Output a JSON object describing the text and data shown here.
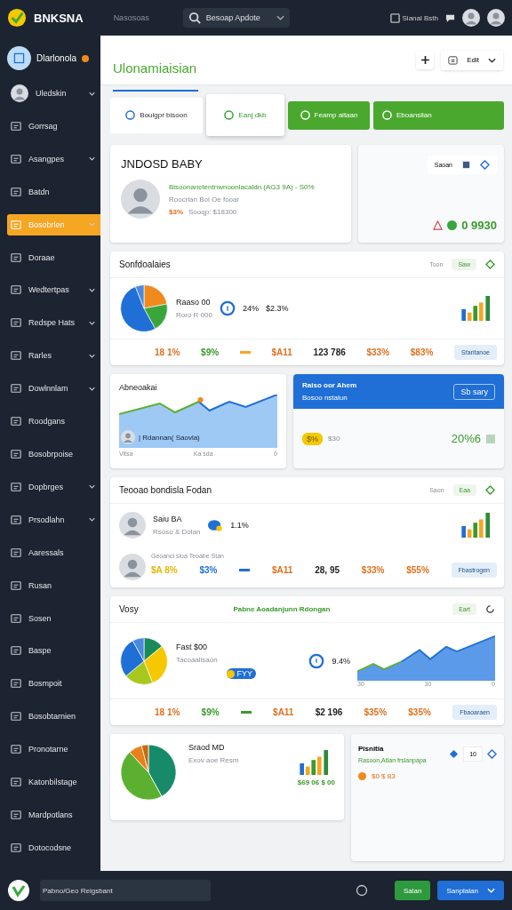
{
  "topbar": {
    "brand": "BNKSNA",
    "section": "Nasosoas",
    "search": {
      "value": "Besoap Apdote"
    },
    "account": "Sianal Bsth"
  },
  "sidebar": {
    "profile": {
      "name": "Dlarlonola",
      "badge": true
    },
    "items": [
      {
        "label": "Uledskin",
        "kind": "user",
        "expandable": true,
        "selected": false
      },
      {
        "label": "Gorrsag",
        "kind": "item",
        "expandable": false,
        "selected": false
      },
      {
        "label": "Asangpes",
        "kind": "item",
        "expandable": true,
        "selected": false
      },
      {
        "label": "Batdn",
        "kind": "item",
        "expandable": false,
        "selected": false
      },
      {
        "label": "Bosobrlen",
        "kind": "item",
        "expandable": true,
        "selected": true
      },
      {
        "label": "Doraae",
        "kind": "item",
        "expandable": false,
        "selected": false
      },
      {
        "label": "Wedtertpas",
        "kind": "item",
        "expandable": true,
        "selected": false
      },
      {
        "label": "Redspe Hats",
        "kind": "item",
        "expandable": true,
        "selected": false
      },
      {
        "label": "Rarles",
        "kind": "item",
        "expandable": true,
        "selected": false
      },
      {
        "label": "Dowlnnlam",
        "kind": "item",
        "expandable": true,
        "selected": false
      },
      {
        "label": "Roodgans",
        "kind": "item",
        "expandable": false,
        "selected": false
      },
      {
        "label": "Bosobrpoise",
        "kind": "item",
        "expandable": false,
        "selected": false
      },
      {
        "label": "Dopbrges",
        "kind": "item",
        "expandable": true,
        "selected": false
      },
      {
        "label": "Prsodlahn",
        "kind": "item",
        "expandable": true,
        "selected": false
      },
      {
        "label": "Aaressals",
        "kind": "item",
        "expandable": false,
        "selected": false
      },
      {
        "label": "Rusan",
        "kind": "item",
        "expandable": false,
        "selected": false
      },
      {
        "label": "Sosen",
        "kind": "item",
        "expandable": false,
        "selected": false
      },
      {
        "label": "Baspe",
        "kind": "item",
        "expandable": false,
        "selected": false
      },
      {
        "label": "Bosmpoit",
        "kind": "item",
        "expandable": false,
        "selected": false
      },
      {
        "label": "Bosobtarnien",
        "kind": "item",
        "expandable": false,
        "selected": false
      },
      {
        "label": "Pronotarne",
        "kind": "item",
        "expandable": false,
        "selected": false
      },
      {
        "label": "Katonbilstage",
        "kind": "item",
        "expandable": false,
        "selected": false
      },
      {
        "label": "Mardpotlans",
        "kind": "item",
        "expandable": false,
        "selected": false
      },
      {
        "label": "Dotocodsne",
        "kind": "item",
        "expandable": false,
        "selected": false
      }
    ]
  },
  "header": {
    "title": "Ulonamiaisian",
    "action": "Edit"
  },
  "actions": [
    {
      "label": "Bouigpr bisoon",
      "kind": "outline"
    },
    {
      "label": "Eanj dkb",
      "kind": "raised"
    },
    {
      "label": "Feamp aitaan",
      "kind": "filled"
    },
    {
      "label": "Eboanslian",
      "kind": "filled"
    }
  ],
  "profile_card": {
    "title": "JNDOSD BABY",
    "headline": "Bisoonanctentnwnoonlacaldn  (AG3 9A) - S0%",
    "subtitle": "Roocrlan Bol Oe fooar",
    "tag": "$3%",
    "amount": "Sooqp: $18300"
  },
  "side_card": {
    "pill": "Saoan",
    "value": "0 9930"
  },
  "summary_card": {
    "title": "Sonfdoalaies",
    "meta": "Toon",
    "pill": "Saw",
    "name": "Raaso 00",
    "note": "Roro R 000",
    "rate": "24%",
    "change": "$2.3%",
    "footer": [
      {
        "kind": "text",
        "text": "18 1%",
        "color": "#e0701e"
      },
      {
        "kind": "text",
        "text": "$9%",
        "color": "#3a9a2c"
      },
      {
        "kind": "dash",
        "color": "#f5a623"
      },
      {
        "kind": "text",
        "text": "$A11",
        "color": "#e0701e"
      },
      {
        "kind": "text",
        "text": "123 786",
        "color": "#222222"
      },
      {
        "kind": "text",
        "text": "$33%",
        "color": "#e0701e"
      },
      {
        "kind": "text",
        "text": "$83%",
        "color": "#e0701e"
      }
    ],
    "button": "Sfaritanoe"
  },
  "trend_card": {
    "title": "Abneoakai",
    "overlay": "| Rdannan( Saovla)",
    "axis": [
      "Vitsa",
      "Ka sda",
      "0"
    ]
  },
  "promo_card": {
    "title": "Raiso oor Ahem",
    "subtitle": "Bosoo nstaiun",
    "button": "Sb sary",
    "pill": "$%",
    "amount": "$30",
    "rate": "20%6"
  },
  "team_card": {
    "title": "Teooao bondisla Fodan",
    "meta": "Saon",
    "pill": "Eaa",
    "name": "Saiu BA",
    "role": "Rsoso & Dolan",
    "rate": "1.1%",
    "caption": "Geoancl sloa Teoabe Stan",
    "footer": [
      {
        "kind": "text",
        "text": "$A 8%",
        "color": "#e8b400"
      },
      {
        "kind": "text",
        "text": "$3%",
        "color": "#1f6fd6"
      },
      {
        "kind": "dash",
        "color": "#1f6fd6"
      },
      {
        "kind": "text",
        "text": "$A11",
        "color": "#e0701e"
      },
      {
        "kind": "text",
        "text": "28, 95",
        "color": "#222222"
      },
      {
        "kind": "text",
        "text": "$33%",
        "color": "#e0701e"
      },
      {
        "kind": "text",
        "text": "$55%",
        "color": "#e0701e"
      }
    ],
    "button": "Fbastrogen"
  },
  "growth_card": {
    "title": "Vosy",
    "headline": "Pabne Aoadanjunn Rdongan",
    "pill": "Eart",
    "name": "Fast $00",
    "note": "Tacoaallsaon",
    "tag": "FYY",
    "rate": "9.4%",
    "axis": [
      "30",
      "30",
      "0"
    ],
    "footer": [
      {
        "kind": "text",
        "text": "18 1%",
        "color": "#e0701e"
      },
      {
        "kind": "text",
        "text": "$9%",
        "color": "#3a9a2c"
      },
      {
        "kind": "dash",
        "color": "#3a9a2c"
      },
      {
        "kind": "text",
        "text": "$A11",
        "color": "#e0701e"
      },
      {
        "kind": "text",
        "text": "$2 196",
        "color": "#222222"
      },
      {
        "kind": "text",
        "text": "$35%",
        "color": "#e0701e"
      },
      {
        "kind": "text",
        "text": "$35%",
        "color": "#e0701e"
      }
    ],
    "button": "Fbaoaraen"
  },
  "mix_card": {
    "name": "Sraod MD",
    "note": "Exov aoe Resm",
    "total": "$69 06 $ 00"
  },
  "notice_card": {
    "title": "Pisnitia",
    "subtitle": "Rasoon,Atlan frslanpapa",
    "count": "10",
    "amount": "$0 $ 83"
  },
  "bottombar": {
    "field": {
      "value": "Pabno/Geo Reigsbant"
    },
    "primary": "Salan",
    "secondary": "Sanplalan"
  }
}
